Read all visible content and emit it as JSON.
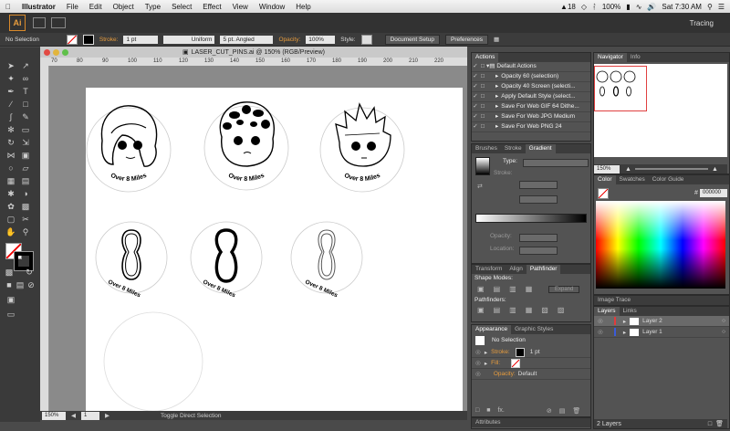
{
  "menubar": {
    "app": "Illustrator",
    "items": [
      "File",
      "Edit",
      "Object",
      "Type",
      "Select",
      "Effect",
      "View",
      "Window",
      "Help"
    ],
    "status": {
      "adobe_count": "18",
      "battery": "100%",
      "clock": "Sat 7:30 AM"
    }
  },
  "appbar": {
    "logo": "Ai",
    "workspace": "Tracing"
  },
  "control": {
    "selection": "No Selection",
    "stroke_label": "Stroke:",
    "stroke_value": "1 pt",
    "profile": "Uniform",
    "brush": "5 pt. Angled",
    "opacity_label": "Opacity:",
    "opacity_value": "100%",
    "style_label": "Style:",
    "doc_setup": "Document Setup",
    "preferences": "Preferences"
  },
  "document": {
    "title": "LASER_CUT_PINS.ai @ 150% (RGB/Preview)",
    "zoom": "150%",
    "page": "1",
    "status": "Toggle Direct Selection",
    "ruler_ticks": [
      "70",
      "80",
      "90",
      "100",
      "110",
      "120",
      "130",
      "140",
      "150",
      "160",
      "170",
      "180",
      "190",
      "200",
      "210",
      "220"
    ],
    "pin_caption": "Over 8 Miles"
  },
  "actions": {
    "tab": "Actions",
    "set": "Default Actions",
    "items": [
      "Opacity 60 (selection)",
      "Opacity 40 Screen (selecti...",
      "Apply Default Style (select...",
      "Save For Web GIF 64 Dithe...",
      "Save For Web JPG Medium",
      "Save For Web PNG 24"
    ]
  },
  "gradient": {
    "tabs": [
      "Brushes",
      "Stroke",
      "Gradient"
    ],
    "type_label": "Type:",
    "stroke_label": "Stroke:",
    "opacity_label": "Opacity:",
    "location_label": "Location:"
  },
  "pathfinder": {
    "tabs": [
      "Transform",
      "Align",
      "Pathfinder"
    ],
    "shape_modes": "Shape Modes:",
    "expand": "Expand",
    "pathfinders": "Pathfinders:"
  },
  "appearance": {
    "tabs": [
      "Appearance",
      "Graphic Styles"
    ],
    "title": "No Selection",
    "stroke_label": "Stroke:",
    "stroke_value": "1 pt",
    "fill_label": "Fill:",
    "opacity_label": "Opacity:",
    "opacity_value": "Default",
    "fx": "fx."
  },
  "attributes": {
    "tab": "Attributes"
  },
  "navigator": {
    "tabs": [
      "Navigator",
      "Info"
    ],
    "zoom": "150%"
  },
  "color": {
    "tabs": [
      "Color",
      "Swatches",
      "Color Guide"
    ],
    "hex": "000000"
  },
  "image_trace": {
    "tab": "Image Trace"
  },
  "layers": {
    "tabs": [
      "Layers",
      "Links"
    ],
    "items": [
      "Layer 2",
      "Layer 1"
    ],
    "count": "2 Layers",
    "colors": [
      "#e23b3b",
      "#3b5bd9"
    ]
  }
}
